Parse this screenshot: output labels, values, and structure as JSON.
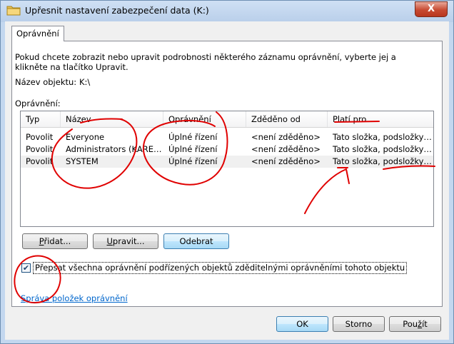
{
  "window": {
    "title": "Upřesnit nastavení zabezpečení data (K:)",
    "close_glyph": "X"
  },
  "tabs": [
    {
      "label": "Oprávnění"
    }
  ],
  "panel": {
    "description": "Pokud chcete zobrazit nebo upravit podrobnosti některého záznamu oprávnění, vyberte jej a klikněte na tlačítko Upravit.",
    "object_name_label": "Název objektu:",
    "object_name_value": "K:\\",
    "permissions_label": "Oprávnění:"
  },
  "table": {
    "columns": [
      "Typ",
      "Název",
      "Oprávnění",
      "Zděděno od",
      "Platí pro"
    ],
    "rows": [
      {
        "type": "Povolit",
        "name": "Everyone",
        "permission": "Úplné řízení",
        "inherited_from": "<není zděděno>",
        "applies_to": "Tato složka, podsložky a ..."
      },
      {
        "type": "Povolit",
        "name": "Administrators (KAREI\\A...",
        "permission": "Úplné řízení",
        "inherited_from": "<není zděděno>",
        "applies_to": "Tato složka, podsložky a ..."
      },
      {
        "type": "Povolit",
        "name": "SYSTEM",
        "permission": "Úplné řízení",
        "inherited_from": "<není zděděno>",
        "applies_to": "Tato složka, podsložky a ..."
      }
    ]
  },
  "buttons": {
    "add": {
      "label": "Přidat...",
      "access_key": "P",
      "rest": "řidat..."
    },
    "edit": {
      "label": "Upravit...",
      "access_key": "U",
      "rest": "pravit..."
    },
    "remove": {
      "label": "Odebrat"
    }
  },
  "checkbox": {
    "label": "Přepsat všechna oprávnění podřízených objektů zděditelnými oprávněními tohoto objektu",
    "checked": true,
    "mark": "✔"
  },
  "link": {
    "label": "Správa položek oprávnění"
  },
  "footer": {
    "ok": "OK",
    "cancel": "Storno",
    "apply": {
      "label": "Použít",
      "pre": "Pou",
      "access_key": "ž",
      "post": "ít"
    }
  },
  "colors": {
    "annotation": "#e00000",
    "link": "#0066cc",
    "window_frame": "#c3d7ef"
  }
}
